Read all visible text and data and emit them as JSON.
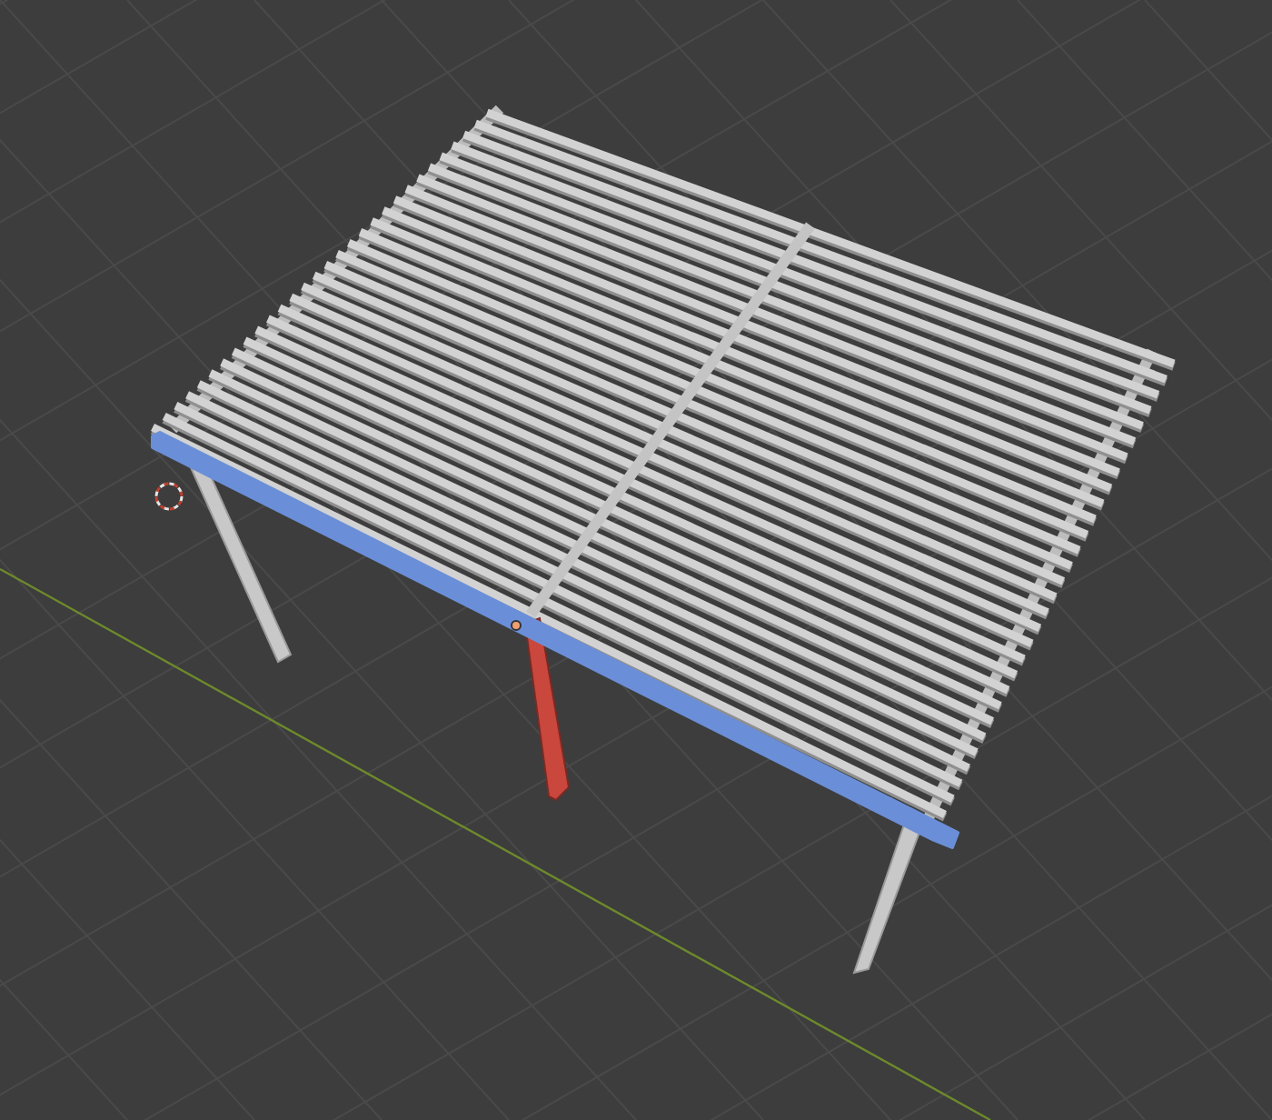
{
  "viewport": {
    "objects": [
      {
        "kind": "beam",
        "color": "#6a8fd8"
      },
      {
        "kind": "post",
        "color": "#c9473d"
      }
    ]
  }
}
